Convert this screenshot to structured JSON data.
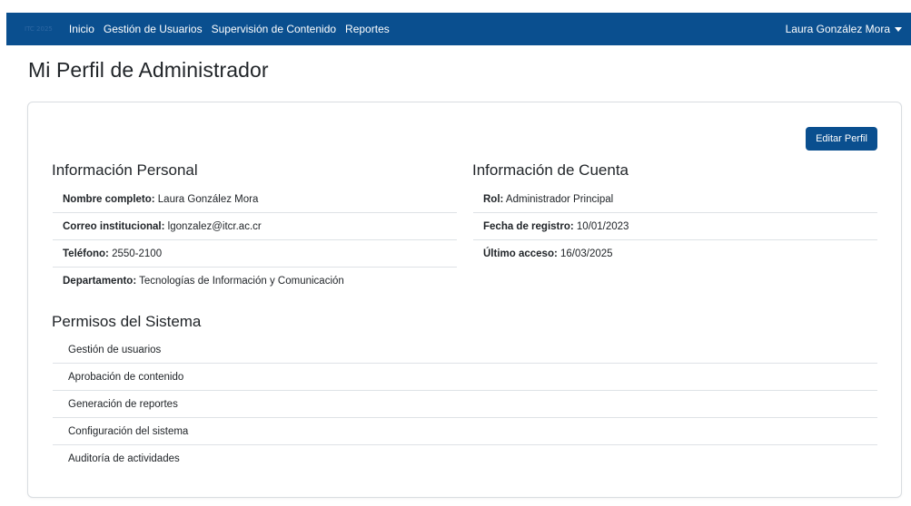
{
  "navbar": {
    "brand": "ITC 2025",
    "links": [
      "Inicio",
      "Gestión de Usuarios",
      "Supervisión de Contenido",
      "Reportes"
    ],
    "user_name": "Laura González Mora",
    "bg_color": "#0a4f8f"
  },
  "page": {
    "title": "Mi Perfil de Administrador"
  },
  "card": {
    "edit_button": "Editar Perfil",
    "personal": {
      "title": "Información Personal",
      "rows": [
        {
          "label": "Nombre completo:",
          "value": " Laura González Mora"
        },
        {
          "label": "Correo institucional:",
          "value": " lgonzalez@itcr.ac.cr"
        },
        {
          "label": "Teléfono:",
          "value": " 2550-2100"
        },
        {
          "label": "Departamento:",
          "value": " Tecnologías de Información y Comunicación"
        }
      ]
    },
    "account": {
      "title": "Información de Cuenta",
      "rows": [
        {
          "label": "Rol:",
          "value": " Administrador Principal"
        },
        {
          "label": "Fecha de registro:",
          "value": " 10/01/2023"
        },
        {
          "label": "Último acceso:",
          "value": " 16/03/2025"
        }
      ]
    },
    "permissions": {
      "title": "Permisos del Sistema",
      "items": [
        "Gestión de usuarios",
        "Aprobación de contenido",
        "Generación de reportes",
        "Configuración del sistema",
        "Auditoría de actividades"
      ]
    }
  }
}
